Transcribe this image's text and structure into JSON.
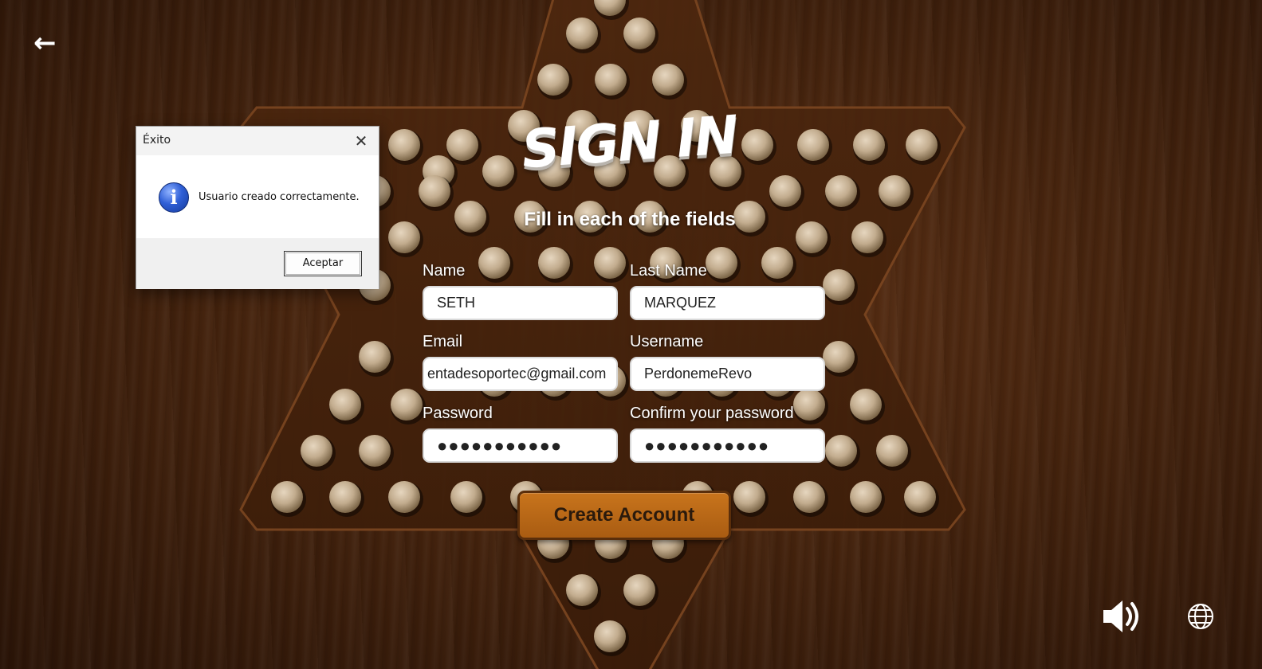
{
  "page": {
    "logo_text": "Sign In",
    "subtitle": "Fill in each of the fields"
  },
  "nav": {
    "back_icon": "arrow-left-icon"
  },
  "form": {
    "name_label": "Name",
    "name_value": "SETH",
    "last_name_label": "Last Name",
    "last_name_value": "MARQUEZ",
    "email_label": "Email",
    "email_value": "entadesoportec@gmail.com",
    "username_label": "Username",
    "username_value": "PerdonemeRevo",
    "password_label": "Password",
    "password_value": "●●●●●●●●●●●",
    "confirm_label": "Confirm your password",
    "confirm_value": "●●●●●●●●●●●",
    "submit_label": "Create Account"
  },
  "controls": {
    "sound_icon": "speaker-icon",
    "language_icon": "globe-icon"
  },
  "dialog": {
    "title": "Éxito",
    "message": "Usuario creado correctamente.",
    "ok_label": "Aceptar",
    "icon": "info-icon"
  },
  "colors": {
    "button": "#b8661a",
    "wood_dark": "#2a1407",
    "wood_mid": "#5a2f14",
    "peg": "#cbb79c"
  }
}
